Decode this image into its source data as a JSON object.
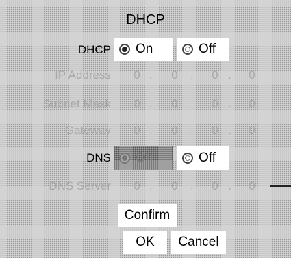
{
  "title": "DHCP",
  "dhcp": {
    "label": "DHCP",
    "on_label": "On",
    "off_label": "Off",
    "selected": "On"
  },
  "ip_address": {
    "label": "IP Address",
    "octets": [
      "0",
      "0",
      "0",
      "0"
    ]
  },
  "subnet_mask": {
    "label": "Subnet Mask",
    "octets": [
      "0",
      "0",
      "0",
      "0"
    ]
  },
  "gateway": {
    "label": "Gateway",
    "octets": [
      "0",
      "0",
      "0",
      "0"
    ]
  },
  "dns": {
    "label": "DNS",
    "on_label": "On",
    "off_label": "Off",
    "selected": "On"
  },
  "dns_server": {
    "label": "DNS Server",
    "octets": [
      "0",
      "0",
      "0",
      "0"
    ]
  },
  "buttons": {
    "confirm": "Confirm",
    "ok": "OK",
    "cancel": "Cancel"
  }
}
